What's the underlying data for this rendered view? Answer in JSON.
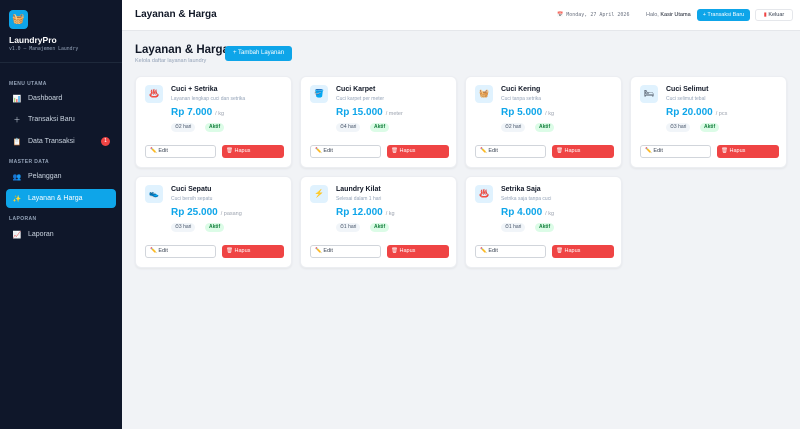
{
  "sidebar": {
    "logo_glyph": "🧺",
    "brand": "LaundryPro",
    "version": "v1.0 — Manajemen Laundry",
    "sections": {
      "main": "MENU UTAMA",
      "master": "MASTER DATA",
      "report": "LAPORAN"
    },
    "items": [
      {
        "label": "Dashboard",
        "icon": "📊",
        "icon_name": "chart-icon"
      },
      {
        "label": "Transaksi Baru",
        "icon": "＋",
        "icon_name": "plus-icon"
      },
      {
        "label": "Data Transaksi",
        "icon": "📋",
        "icon_name": "clipboard-icon",
        "badge": "1"
      },
      {
        "label": "Pelanggan",
        "icon": "👥",
        "icon_name": "users-icon"
      },
      {
        "label": "Layanan & Harga",
        "icon": "✨",
        "icon_name": "sparkle-icon",
        "active": true
      },
      {
        "label": "Laporan",
        "icon": "📈",
        "icon_name": "report-icon"
      }
    ]
  },
  "header": {
    "title": "Layanan & Harga",
    "date": "📅 Monday, 27 April 2026",
    "greeting": "Halo,",
    "user": "Kasir Utama",
    "new_transaction_label": "+ Transaksi Baru",
    "logout_label": "Keluar"
  },
  "page": {
    "title": "Layanan & Harga",
    "subtitle": "Kelola daftar layanan laundry",
    "add_button_label": "+ Tambah Layanan"
  },
  "services": [
    {
      "name": "Cuci + Setrika",
      "desc": "Layanan lengkap cuci dan setrika",
      "price": "Rp 7.000",
      "unit": "/ kg",
      "duration": "⏱2 hari",
      "status": "Aktif",
      "icon": "♨️",
      "icon_name": "steam-icon"
    },
    {
      "name": "Cuci Karpet",
      "desc": "Cuci karpet per meter",
      "price": "Rp 15.000",
      "unit": "/ meter",
      "duration": "⏱4 hari",
      "status": "Aktif",
      "icon": "🪣",
      "icon_name": "bucket-icon"
    },
    {
      "name": "Cuci Kering",
      "desc": "Cuci tanpa setrika",
      "price": "Rp 5.000",
      "unit": "/ kg",
      "duration": "⏱2 hari",
      "status": "Aktif",
      "icon": "🧺",
      "icon_name": "basket-icon"
    },
    {
      "name": "Cuci Selimut",
      "desc": "Cuci selimut tebal",
      "price": "Rp 20.000",
      "unit": "/ pcs",
      "duration": "⏱3 hari",
      "status": "Aktif",
      "icon": "🛏",
      "icon_name": "bed-icon"
    },
    {
      "name": "Cuci Sepatu",
      "desc": "Cuci bersih sepatu",
      "price": "Rp 25.000",
      "unit": "/ pasang",
      "duration": "⏱3 hari",
      "status": "Aktif",
      "icon": "👟",
      "icon_name": "shoe-icon"
    },
    {
      "name": "Laundry Kilat",
      "desc": "Selesai dalam 1 hari",
      "price": "Rp 12.000",
      "unit": "/ kg",
      "duration": "⏱1 hari",
      "status": "Aktif",
      "icon": "⚡",
      "icon_name": "lightning-icon"
    },
    {
      "name": "Setrika Saja",
      "desc": "Setrika saja tanpa cuci",
      "price": "Rp 4.000",
      "unit": "/ kg",
      "duration": "⏱1 hari",
      "status": "Aktif",
      "icon": "♨️",
      "icon_name": "iron-icon"
    }
  ],
  "card_actions": {
    "edit_label": "✏️ Edit",
    "delete_label": "🗑 Hapus"
  },
  "colors": {
    "accent": "#0ea5e9",
    "danger": "#ef4444",
    "sidebar_bg": "#0f172a",
    "success_bg": "#dcfce7",
    "success_text": "#15803d"
  }
}
